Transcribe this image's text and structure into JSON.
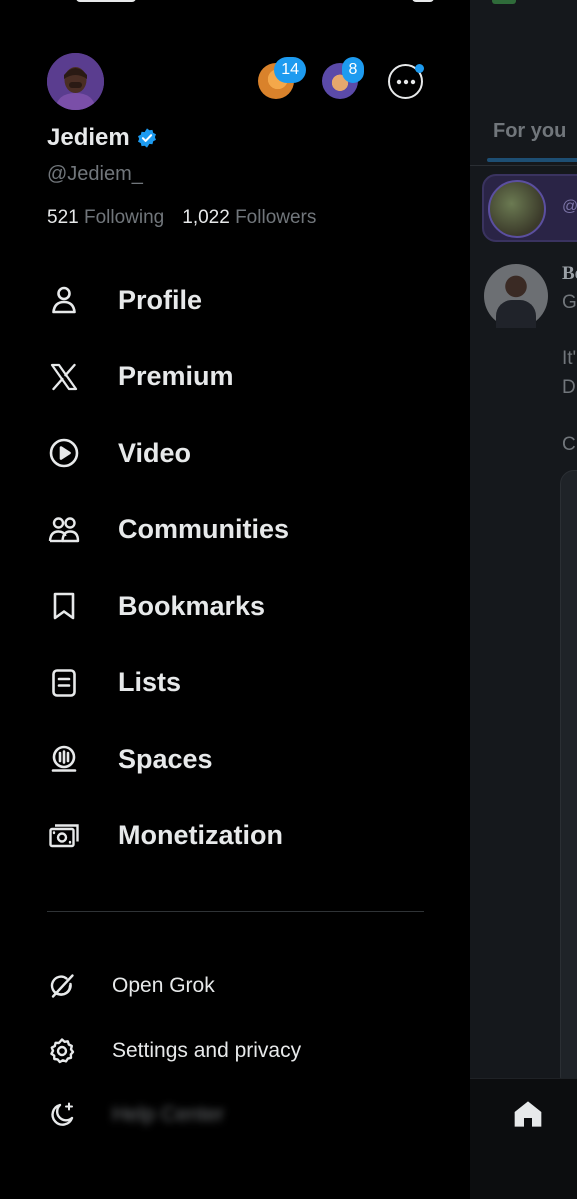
{
  "profile": {
    "display_name": "Jediem",
    "handle": "@Jediem_",
    "following_count": "521",
    "following_label": "Following",
    "followers_count": "1,022",
    "followers_label": "Followers",
    "verified": true
  },
  "account_switcher": {
    "accounts": [
      {
        "badge": "14"
      },
      {
        "badge": "8"
      }
    ],
    "more_icon": "more-horizontal-icon"
  },
  "menu": {
    "items": [
      {
        "label": "Profile",
        "icon": "person-icon"
      },
      {
        "label": "Premium",
        "icon": "x-logo-icon"
      },
      {
        "label": "Video",
        "icon": "play-circle-icon"
      },
      {
        "label": "Communities",
        "icon": "communities-icon"
      },
      {
        "label": "Bookmarks",
        "icon": "bookmark-icon"
      },
      {
        "label": "Lists",
        "icon": "list-icon"
      },
      {
        "label": "Spaces",
        "icon": "spaces-icon"
      },
      {
        "label": "Monetization",
        "icon": "monetization-icon"
      }
    ]
  },
  "secondary_menu": {
    "items": [
      {
        "label": "Open Grok",
        "icon": "grok-icon"
      },
      {
        "label": "Settings and privacy",
        "icon": "gear-icon"
      },
      {
        "label": "Help Center",
        "icon": "moon-sparkle-icon"
      }
    ]
  },
  "background_feed": {
    "tab_label": "For you",
    "line_1": "Bo",
    "line_2": "G",
    "line_3": "It'",
    "line_4": "D",
    "line_5": "C",
    "spaces_handle": "@"
  },
  "colors": {
    "accent": "#1d9bf0",
    "background": "#000000",
    "text_primary": "#e7e9ea",
    "text_secondary": "#71767b"
  }
}
